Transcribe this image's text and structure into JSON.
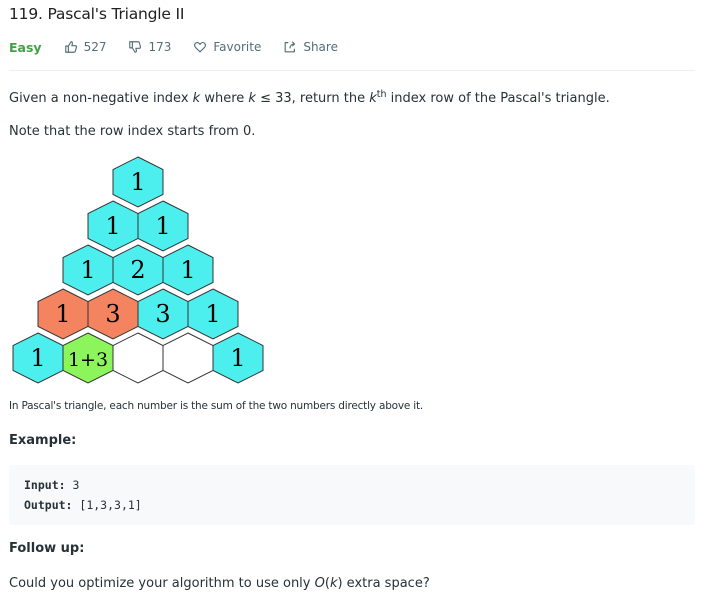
{
  "problem": {
    "title": "119. Pascal's Triangle II",
    "difficulty": "Easy",
    "likes": "527",
    "dislikes": "173",
    "favorite_label": "Favorite",
    "share_label": "Share"
  },
  "description": {
    "line1_a": "Given a non-negative index ",
    "line1_k1": "k",
    "line1_b": " where ",
    "line1_k2": "k",
    "line1_c": " ≤ 33, return the ",
    "line1_k3": "k",
    "line1_sup": "th",
    "line1_d": " index row of the Pascal's triangle.",
    "line2": "Note that the row index starts from 0."
  },
  "figure": {
    "rows": [
      [
        "1"
      ],
      [
        "1",
        "1"
      ],
      [
        "1",
        "2",
        "1"
      ],
      [
        "1",
        "3",
        "3",
        "1"
      ],
      [
        "1",
        "1+3",
        "",
        "",
        "1"
      ]
    ],
    "colors": {
      "cyan": "#4deeee",
      "orange": "#f4845f",
      "green": "#8cf55c",
      "white": "#ffffff"
    },
    "caption": "In Pascal's triangle, each number is the sum of the two numbers directly above it."
  },
  "example": {
    "heading": "Example:",
    "input_label": "Input:",
    "input_value": "3",
    "output_label": "Output:",
    "output_value": "[1,3,3,1]"
  },
  "follow_up": {
    "heading": "Follow up:",
    "text_a": "Could you optimize your algorithm to use only ",
    "text_o": "O",
    "text_b": "(",
    "text_k": "k",
    "text_c": ") extra space?"
  },
  "icons": [
    "thumbs-up-icon",
    "thumbs-down-icon",
    "heart-icon",
    "share-icon"
  ]
}
